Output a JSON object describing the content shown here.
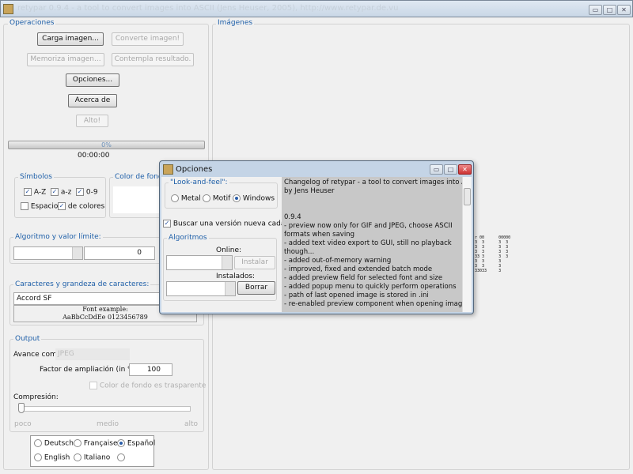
{
  "window": {
    "title": "retypar 0.9.4 - a tool to convert images into ASCII (Jens Heuser, 2005), http://www.retypar.de.vu",
    "minimize": "▭",
    "maximize": "□",
    "close": "✕"
  },
  "operaciones": {
    "legend": "Operaciones",
    "carga": "Carga imagen...",
    "converte": "Converte imagen!",
    "memoriza": "Memoriza imagen...",
    "contempla": "Contempla resultado.",
    "opciones": "Opciones...",
    "acerca": "Acerca de",
    "alto": "Alto!",
    "progress_text": "0%",
    "progress": 0,
    "time": "00:00:00"
  },
  "simbolos": {
    "legend": "Símbolos",
    "az": "A-Z",
    "az_lower": "a-z",
    "digits": "0-9",
    "espacio": "Espacio",
    "colores": "de colores"
  },
  "color_fondo": {
    "legend": "Color de fondo"
  },
  "algoritmo": {
    "legend": "Algoritmo y valor límite:",
    "value": "0"
  },
  "caracteres": {
    "legend": "Caracteres y grandeza de caracteres:",
    "font": "Accord SF",
    "example_title": "Font example:",
    "example_text": "AaBbCcDdEe 0123456789"
  },
  "output": {
    "legend": "Output",
    "avance_label": "Avance como:",
    "avance_value": "JPEG",
    "factor_label": "Factor de ampliación (in %):",
    "factor_value": "100",
    "transparente": "Color de fondo es trasparente",
    "compresion": "Compresión:",
    "poco": "poco",
    "medio": "medio",
    "alto": "alto",
    "compresion_level": 0
  },
  "languages": {
    "deutsch": "Deutsch",
    "francaise": "Française",
    "espanol": "Español",
    "english": "English",
    "italiano": "Italiano",
    "selected": "Español"
  },
  "imagenes": {
    "legend": "Imágenes",
    "ascii": [
      "r 00      00000",
      "3  3      3  3 ",
      "3  3      3  3 ",
      "3  3      3  3 ",
      "33 3      3  3 ",
      "3  3      3    ",
      "3  3      3    ",
      "33033     3    "
    ]
  },
  "dialog": {
    "title": "Opciones",
    "laf_legend": "\"Look-and-feel\":",
    "metal": "Metal",
    "motif": "Motif",
    "windows": "Windows",
    "buscar": "Buscar una versión nueva cada vez",
    "algoritmos_legend": "Algoritmos",
    "online": "Online:",
    "instalar": "Instalar",
    "instalados": "Instalados:",
    "borrar": "Borrar",
    "changelog": [
      "Changelog of retypar - a tool to convert images into ASCII",
      "by Jens Heuser",
      "",
      "",
      "0.9.4",
      "- preview now only for GIF and JPEG, choose ASCII",
      "formats when saving",
      "- added text video export to GUI, still no playback",
      "though...",
      "- added out-of-memory warning",
      "- improved, fixed and extended batch mode",
      "- added preview field for selected font and size",
      "- added popup menu to quickly perform operations",
      "- path of last opened image is stored in .ini",
      "- re-enabled preview component when opening images"
    ]
  }
}
